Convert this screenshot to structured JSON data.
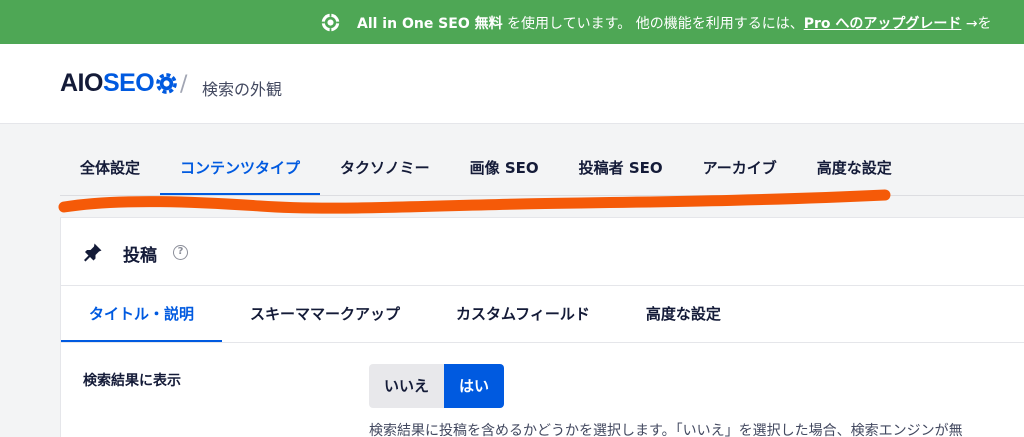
{
  "promo": {
    "brand": "All in One SEO 無料",
    "text": " を使用しています。 他の機能を利用するには、",
    "link": "Pro へのアップグレード",
    "arrow": " →を"
  },
  "header": {
    "logo_aio": "AIO",
    "logo_seo": "SEO",
    "separator": "/",
    "page_title": "検索の外観"
  },
  "main_tabs": [
    {
      "label": "全体設定",
      "active": false
    },
    {
      "label": "コンテンツタイプ",
      "active": true
    },
    {
      "label": "タクソノミー",
      "active": false
    },
    {
      "label": "画像 SEO",
      "active": false
    },
    {
      "label": "投稿者 SEO",
      "active": false
    },
    {
      "label": "アーカイブ",
      "active": false
    },
    {
      "label": "高度な設定",
      "active": false
    }
  ],
  "card": {
    "title": "投稿",
    "help": "?",
    "sub_tabs": [
      {
        "label": "タイトル・説明",
        "active": true
      },
      {
        "label": "スキーママークアップ",
        "active": false
      },
      {
        "label": "カスタムフィールド",
        "active": false
      },
      {
        "label": "高度な設定",
        "active": false
      }
    ],
    "setting": {
      "label": "検索結果に表示",
      "option_no": "いいえ",
      "option_yes": "はい",
      "selected": "はい",
      "description": "検索結果に投稿を含めるかどうかを選択します。「いいえ」を選択した場合、検索エンジンが無"
    }
  },
  "colors": {
    "promo_bg": "#4ea755",
    "accent": "#005ae0",
    "annotation": "#f55a08"
  },
  "icons": {
    "promo": "gear-shield-icon",
    "logo": "gear-icon",
    "card": "pin-icon",
    "help": "help-icon"
  }
}
